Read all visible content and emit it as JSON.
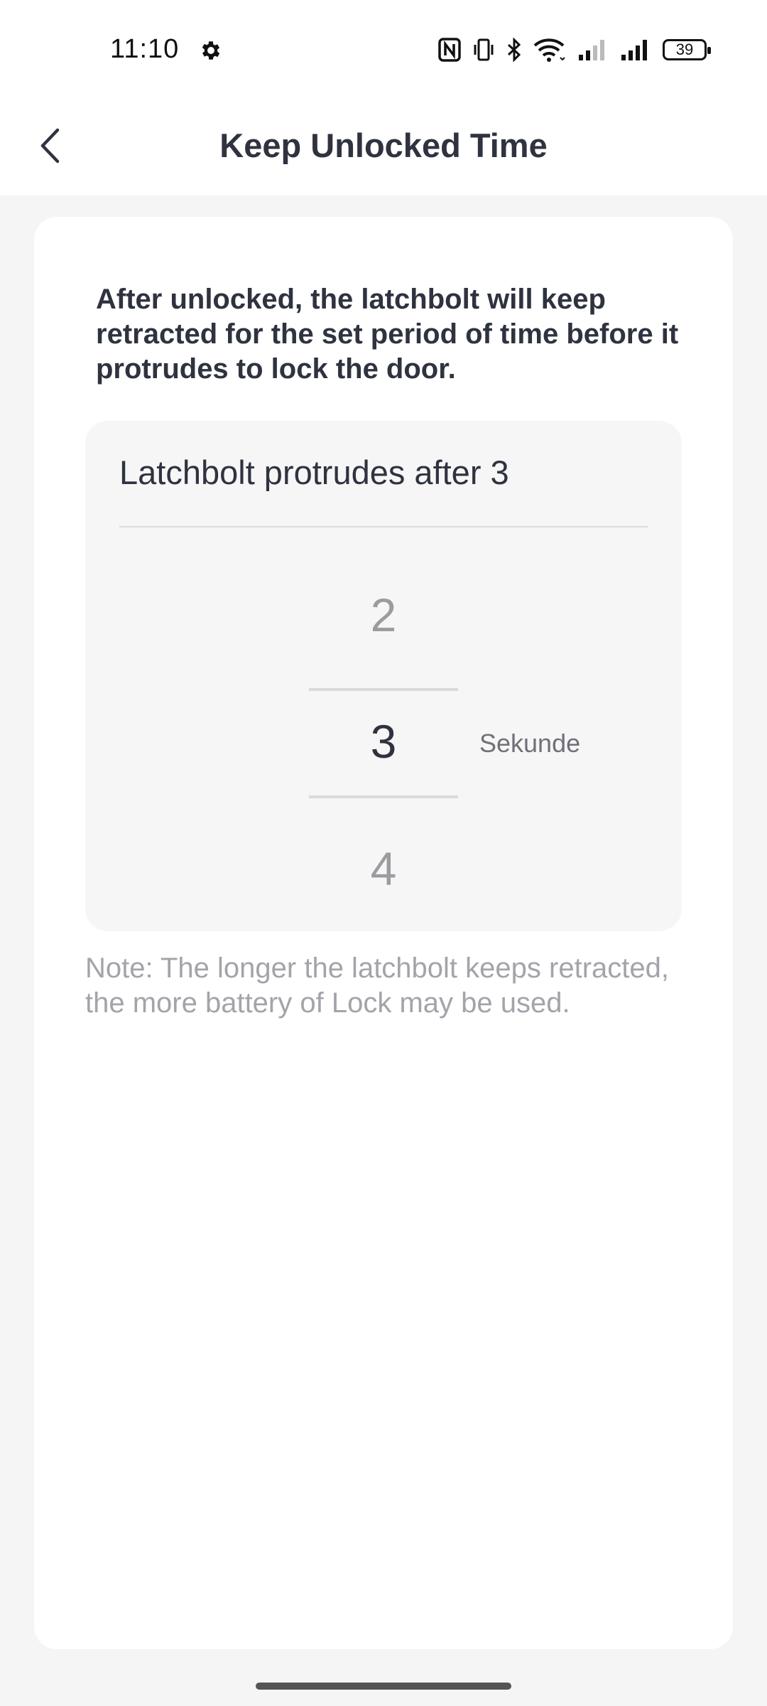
{
  "status_bar": {
    "time": "11:10",
    "battery": "39",
    "icons": [
      "settings-gear-icon",
      "nfc-icon",
      "vibrate-icon",
      "bluetooth-icon",
      "wifi-icon",
      "signal-weak-icon",
      "signal-strong-icon",
      "battery-icon"
    ]
  },
  "header": {
    "back_icon": "chevron-left-icon",
    "title": "Keep Unlocked Time"
  },
  "card": {
    "description": "After unlocked, the latchbolt will keep retracted for the set period of time before it protrudes to lock the door.",
    "picker": {
      "heading": "Latchbolt protrudes after 3",
      "previous_value": "2",
      "selected_value": "3",
      "next_value": "4",
      "unit": "Sekunde"
    },
    "note": "Note: The longer the latchbolt keeps retracted, the more battery of Lock may be used."
  }
}
